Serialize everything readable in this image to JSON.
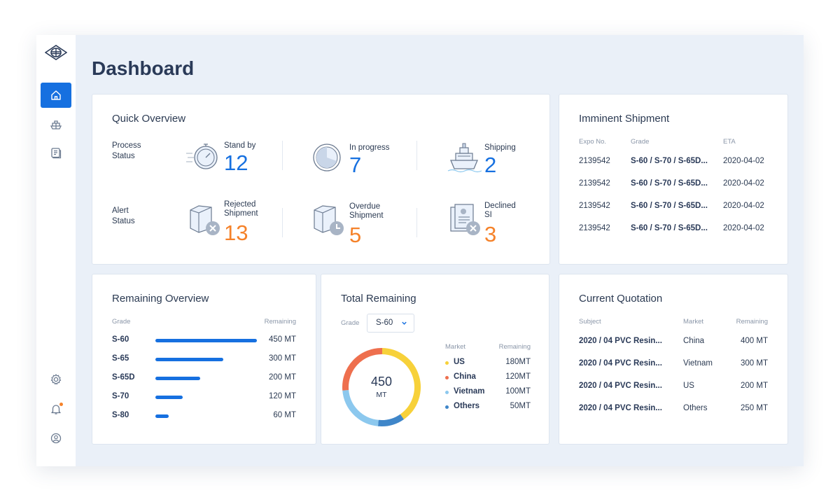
{
  "page": {
    "title": "Dashboard"
  },
  "sidebar": {
    "items": [
      {
        "name": "home",
        "active": true
      },
      {
        "name": "shipment"
      },
      {
        "name": "document"
      },
      {
        "name": "settings"
      },
      {
        "name": "notifications",
        "has_badge": true
      },
      {
        "name": "profile"
      }
    ]
  },
  "quick_overview": {
    "title": "Quick Overview",
    "process_label": "Process\nStatus",
    "alert_label": "Alert\nStatus",
    "process": [
      {
        "label": "Stand by",
        "value": "12",
        "icon": "stopwatch-icon"
      },
      {
        "label": "In progress",
        "value": "7",
        "icon": "pie-progress-icon"
      },
      {
        "label": "Shipping",
        "value": "2",
        "icon": "ship-icon"
      }
    ],
    "alert": [
      {
        "label": "Rejected\nShipment",
        "value": "13",
        "icon": "rejected-box-icon"
      },
      {
        "label": "Overdue\nShipment",
        "value": "5",
        "icon": "overdue-box-icon"
      },
      {
        "label": "Declined\nSI",
        "value": "3",
        "icon": "declined-document-icon"
      }
    ]
  },
  "imminent_shipment": {
    "title": "Imminent Shipment",
    "columns": [
      "Expo No.",
      "Grade",
      "ETA"
    ],
    "rows": [
      [
        "2139542",
        "S-60 / S-70 / S-65D...",
        "2020-04-02"
      ],
      [
        "2139542",
        "S-60 / S-70 / S-65D...",
        "2020-04-02"
      ],
      [
        "2139542",
        "S-60 / S-70 / S-65D...",
        "2020-04-02"
      ],
      [
        "2139542",
        "S-60 / S-70 / S-65D...",
        "2020-04-02"
      ]
    ]
  },
  "remaining_overview": {
    "title": "Remaining Overview",
    "columns": [
      "Grade",
      "Remaining"
    ],
    "rows": [
      {
        "grade": "S-60",
        "remaining": "450 MT",
        "value": 450
      },
      {
        "grade": "S-65",
        "remaining": "300 MT",
        "value": 300
      },
      {
        "grade": "S-65D",
        "remaining": "200 MT",
        "value": 200
      },
      {
        "grade": "S-70",
        "remaining": "120 MT",
        "value": 120
      },
      {
        "grade": "S-80",
        "remaining": "60 MT",
        "value": 60
      }
    ],
    "max": 450
  },
  "total_remaining": {
    "title": "Total Remaining",
    "grade_label": "Grade",
    "selected_grade": "S-60",
    "total": "450",
    "unit": "MT",
    "columns": [
      "Market",
      "Remaining"
    ],
    "markets": [
      {
        "name": "US",
        "remaining": "180MT",
        "value": 180,
        "color": "#f7d13a"
      },
      {
        "name": "China",
        "remaining": "120MT",
        "value": 120,
        "color": "#ee6f4e"
      },
      {
        "name": "Vietnam",
        "remaining": "100MT",
        "value": 100,
        "color": "#8cc8ee"
      },
      {
        "name": "Others",
        "remaining": "50MT",
        "value": 50,
        "color": "#3f86c9"
      }
    ],
    "donut_order": [
      {
        "value": 180,
        "color": "#f7d13a"
      },
      {
        "value": 50,
        "color": "#3f86c9"
      },
      {
        "value": 100,
        "color": "#8cc8ee"
      },
      {
        "value": 120,
        "color": "#ee6f4e"
      }
    ]
  },
  "current_quotation": {
    "title": "Current Quotation",
    "columns": [
      "Subject",
      "Market",
      "Remaining"
    ],
    "rows": [
      [
        "2020 / 04 PVC Resin...",
        "China",
        "400 MT"
      ],
      [
        "2020 / 04 PVC Resin...",
        "Vietnam",
        "300 MT"
      ],
      [
        "2020 / 04 PVC Resin...",
        "US",
        "200 MT"
      ],
      [
        "2020 / 04 PVC Resin...",
        "Others",
        "250 MT"
      ]
    ]
  },
  "colors": {
    "accent": "#1670e0",
    "alert": "#f5822a",
    "background": "#eaf0f8"
  }
}
